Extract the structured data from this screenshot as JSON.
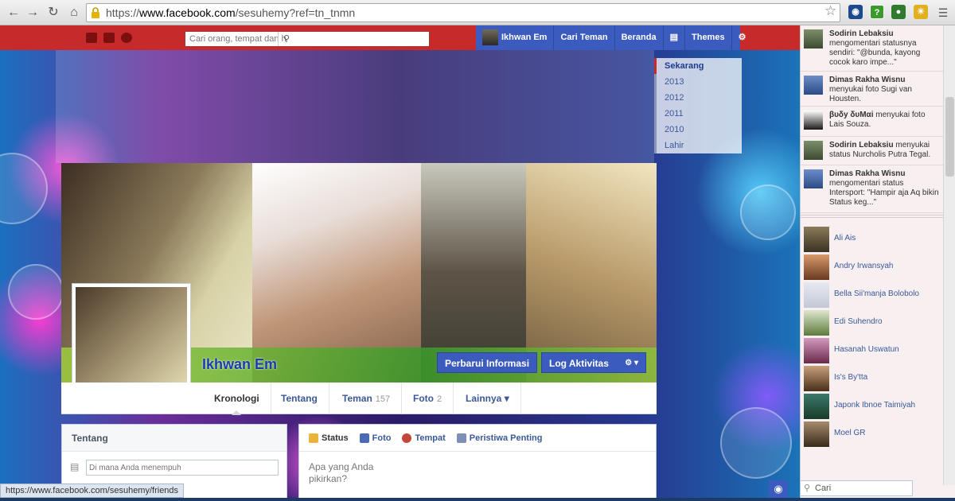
{
  "browser": {
    "url_scheme": "https://",
    "url_host": "www.facebook.com",
    "url_path": "/sesuhemy?ref=tn_tnmn",
    "status_url": "https://www.facebook.com/sesuhemy/friends"
  },
  "fb_bar": {
    "search_placeholder": "Cari orang, tempat dan h",
    "user_name": "Ikhwan Em",
    "find_friends": "Cari Teman",
    "home": "Beranda",
    "themes": "Themes"
  },
  "timeline_years": [
    "Sekarang",
    "2013",
    "2012",
    "2011",
    "2010",
    "Lahir"
  ],
  "profile": {
    "name": "Ikhwan Em",
    "update_info_button": "Perbarui Informasi",
    "activity_log_button": "Log Aktivitas"
  },
  "tabs": [
    {
      "label": "Kronologi",
      "count": ""
    },
    {
      "label": "Tentang",
      "count": ""
    },
    {
      "label": "Teman",
      "count": "157"
    },
    {
      "label": "Foto",
      "count": "2"
    },
    {
      "label": "Lainnya",
      "count": ""
    }
  ],
  "about_panel": {
    "title": "Tentang",
    "input_placeholder": "Di mana Anda menempuh"
  },
  "composer": {
    "tabs": [
      "Status",
      "Foto",
      "Tempat",
      "Peristiwa Penting"
    ],
    "placeholder_line1": "Apa yang Anda",
    "placeholder_line2": "pikirkan?"
  },
  "ticker": [
    {
      "name": "Sodirin Lebaksiu",
      "text": "mengomentari statusnya sendiri: \"@bunda, kayong cocok karo impe...\""
    },
    {
      "name": "Dimas Rakha Wisnu",
      "text": "menyukai foto Sugi van Housten."
    },
    {
      "name": "βυδу δυΜαі",
      "text": "menyukai foto Lais Souza."
    },
    {
      "name": "Sodirin Lebaksiu",
      "text": "menyukai status Nurcholis Putra Tegal."
    },
    {
      "name": "Dimas Rakha Wisnu",
      "text": "mengomentari status Intersport: \"Hampir aja Aq bikin Status keg...\""
    }
  ],
  "chat_friends": [
    "Ali Ais",
    "Andry Irwansyah",
    "Bella Sii'manja Bolobolo",
    "Edi Suhendro",
    "Hasanah Uswatun",
    "Is's By'tta",
    "Japonk Ibnoe Taimiyah",
    "Moel GR"
  ],
  "chat_search_placeholder": "Cari",
  "colors": {
    "fb_red_bar": "#c72a2a",
    "fb_blue": "#3b5bbf",
    "link": "#3b5998"
  }
}
